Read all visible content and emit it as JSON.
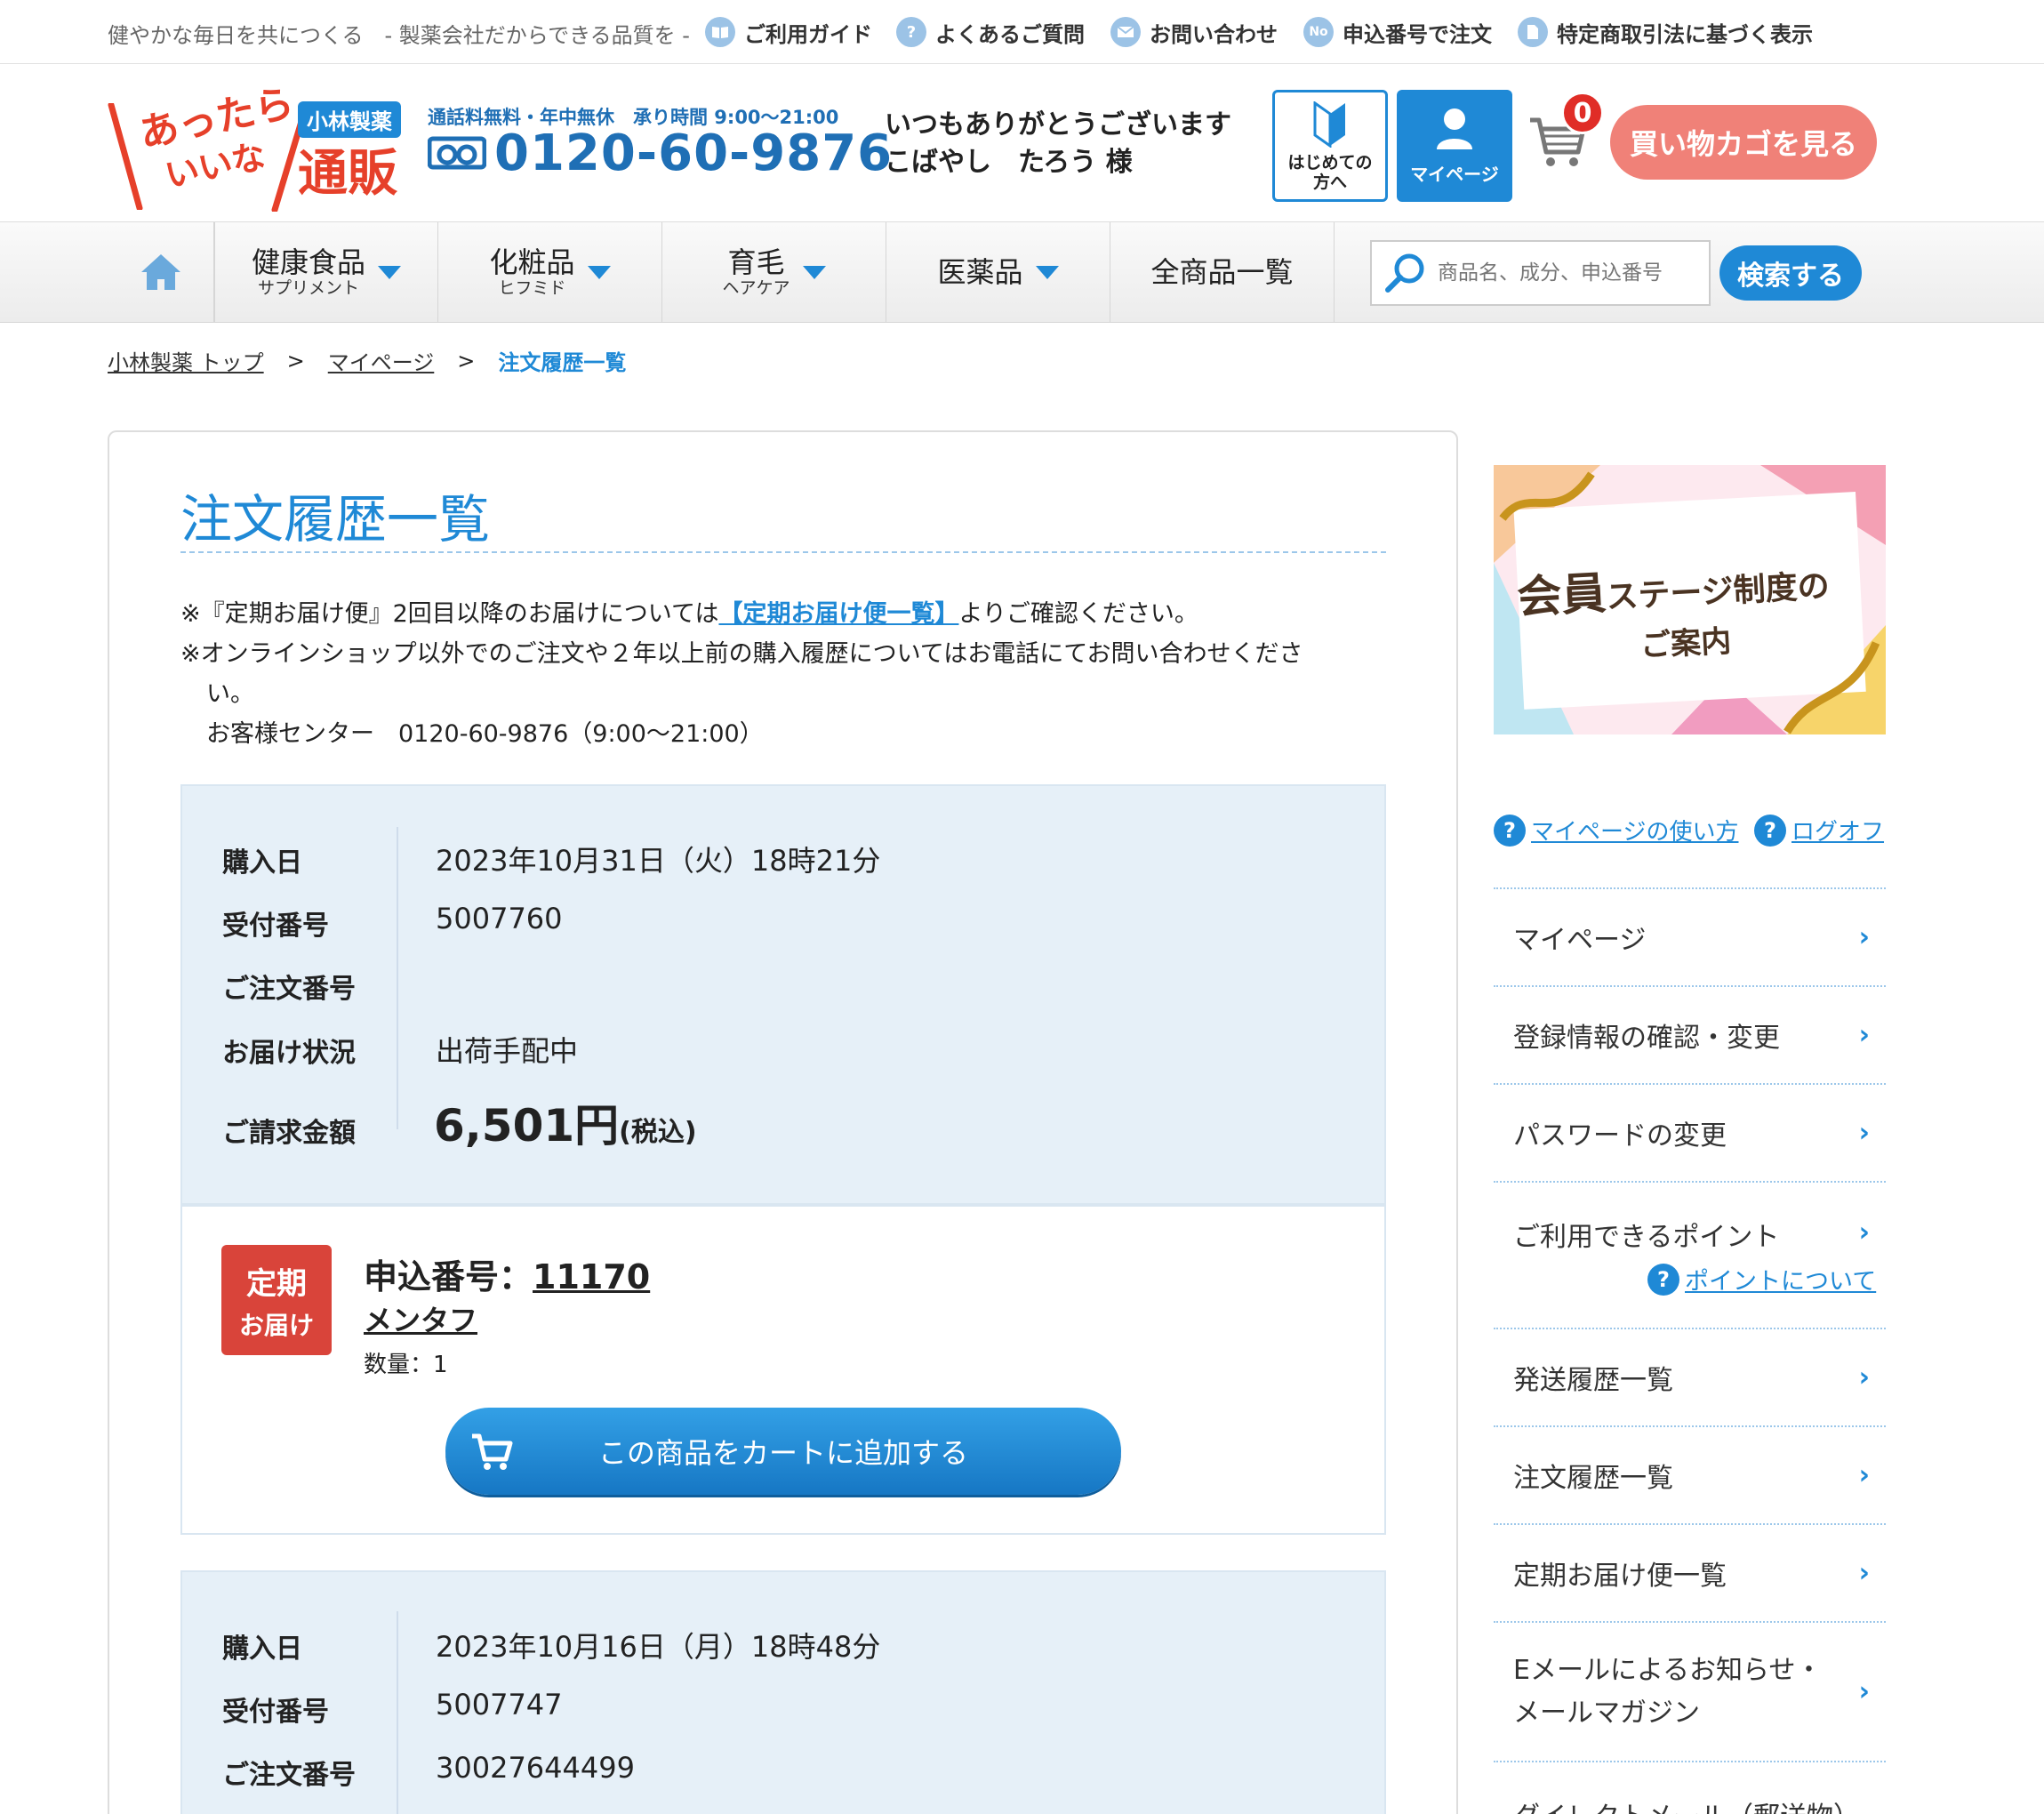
{
  "topbar": {
    "tagline": "健やかな毎日を共につくる　- 製薬会社だからできる品質を -",
    "links": [
      {
        "label": "ご利用ガイド",
        "icon": "book-icon"
      },
      {
        "label": "よくあるご質問",
        "icon": "question-icon"
      },
      {
        "label": "お問い合わせ",
        "icon": "mail-icon"
      },
      {
        "label": "申込番号で注文",
        "icon": "no-badge-icon"
      },
      {
        "label": "特定商取引法に基づく表示",
        "icon": "document-icon"
      }
    ]
  },
  "header": {
    "logo_badge": "小林製薬",
    "logo_line1": "あったら",
    "logo_line2": "いいな",
    "logo_line3": "通販",
    "phone_note": "通話料無料・年中無休　承り時間 9:00〜21:00",
    "phone_number": "0120-60-9876",
    "greeting_line1": "いつもありがとうございます",
    "greeting_line2": "こばやし　たろう 様",
    "first_time_label_1": "はじめての",
    "first_time_label_2": "方へ",
    "mypage_label": "マイページ",
    "cart_count": "0",
    "cart_button": "買い物カゴを見る"
  },
  "nav": {
    "items": [
      {
        "main": "健康食品",
        "sub": "サプリメント"
      },
      {
        "main": "化粧品",
        "sub": "ヒフミド"
      },
      {
        "main": "育毛",
        "sub": "ヘアケア"
      },
      {
        "main": "医薬品",
        "sub": ""
      },
      {
        "main": "全商品一覧",
        "sub": ""
      }
    ],
    "search_placeholder": "商品名、成分、申込番号",
    "search_button": "検索する"
  },
  "breadcrumb": {
    "items": [
      "小林製薬 トップ",
      "マイページ",
      "注文履歴一覧"
    ],
    "separator": ">"
  },
  "main": {
    "title": "注文履歴一覧",
    "note1_prefix": "※『定期お届け便』2回目以降のお届けについては",
    "note1_link": "【定期お届け便一覧】",
    "note1_suffix": "よりご確認ください。",
    "note2_line1": "※オンラインショップ以外でのご注文や２年以上前の購入履歴についてはお電話にてお問い合わせくださ",
    "note2_line2": "い。",
    "note3": "お客様センター　0120-60-9876（9:00〜21:00）",
    "labels": {
      "purchase_date": "購入日",
      "receipt_no": "受付番号",
      "order_no": "ご注文番号",
      "delivery_status": "お届け状況",
      "amount": "ご請求金額"
    },
    "orders": [
      {
        "purchase_date": "2023年10月31日（火）18時21分",
        "receipt_no": "5007760",
        "order_no": "",
        "delivery_status": "出荷手配中",
        "amount": "6,501円",
        "amount_tax": "(税込)",
        "item": {
          "badge_line1": "定期",
          "badge_line2": "お届け",
          "application_label": "申込番号：",
          "application_no": "11170",
          "name": "メンタフ",
          "quantity": "数量：1",
          "add_to_cart": "この商品をカートに追加する"
        }
      },
      {
        "purchase_date": "2023年10月16日（月）18時48分",
        "receipt_no": "5007747",
        "order_no": "30027644499"
      }
    ]
  },
  "sidebar": {
    "banner_line1a": "会員",
    "banner_line1b": "ステージ制度の",
    "banner_line2": "ご案内",
    "help_usage": "マイページの使い方",
    "help_logoff": "ログオフ",
    "items": [
      "マイページ",
      "登録情報の確認・変更",
      "パスワードの変更",
      "ご利用できるポイント",
      "発送履歴一覧",
      "注文履歴一覧",
      "定期お届け便一覧",
      "Eメールによるお知らせ・",
      "ダイレクトメール（郵送物）"
    ],
    "email_item_line2": "メールマガジン",
    "points_link": "ポイントについて"
  },
  "colors": {
    "accent": "#1f89d6",
    "cart_button": "#f08178",
    "badge_red": "#d9443a",
    "panel_bg": "#e6f0f8"
  }
}
